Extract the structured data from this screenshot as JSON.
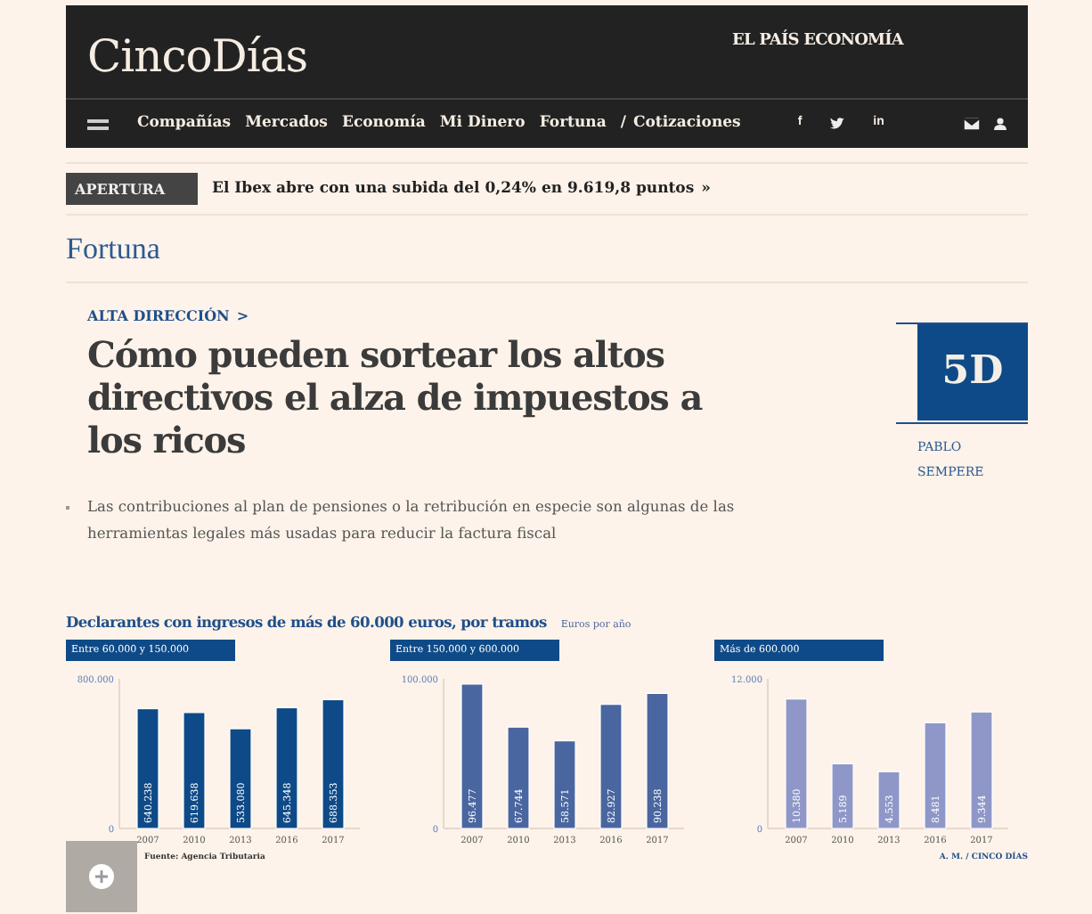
{
  "header": {
    "logo": "CincoDías",
    "partner": "EL PAÍS ECONOMÍA",
    "nav": [
      "Compañías",
      "Mercados",
      "Economía",
      "Mi Dinero",
      "Fortuna"
    ],
    "nav_separator": "/",
    "nav_extra": "Cotizaciones",
    "social": [
      {
        "kind": "text",
        "label": "f"
      },
      {
        "kind": "bird"
      },
      {
        "kind": "text",
        "label": "in"
      }
    ]
  },
  "ticker": {
    "tag": "APERTURA",
    "headline": "El Ibex abre con una subida del 0,24% en 9.619,8 puntos",
    "arrow": "»"
  },
  "section": "Fortuna",
  "article": {
    "kicker": "ALTA DIRECCIÓN",
    "kicker_arrow": ">",
    "title": "Cómo pueden sortear los altos directivos el alza de impuestos a los ricos",
    "summary": "Las contribuciones al plan de pensiones o la retribución en especie son algunas de las herramientas legales más usadas para reducir la factura fiscal",
    "author_logo": "5D",
    "author": "PABLO SEMPERE"
  },
  "infographic": {
    "title": "Declarantes con ingresos de más de 60.000 euros, por tramos",
    "unit": "Euros por año",
    "source": "Fuente: Agencia Tributaria",
    "credit": "A. M. / CINCO DÍAS",
    "panels": [
      {
        "chart_data": {
          "type": "bar",
          "categories": [
            "2007",
            "2010",
            "2013",
            "2016",
            "2017"
          ],
          "series": [
            {
              "name": "Entre 60.000 y 150.000",
              "color": "#0e4a87",
              "values": [
                640238,
                619638,
                533080,
                645348,
                688353
              ]
            }
          ],
          "ylim": [
            0,
            800000
          ],
          "yticks": [
            {
              "value": 0,
              "label": "0"
            },
            {
              "value": 800000,
              "label": "800.000"
            }
          ],
          "value_labels": [
            "640.238",
            "619.638",
            "533.080",
            "645.348",
            "688.353"
          ]
        }
      },
      {
        "chart_data": {
          "type": "bar",
          "categories": [
            "2007",
            "2010",
            "2013",
            "2016",
            "2017"
          ],
          "series": [
            {
              "name": "Entre 150.000 y 600.000",
              "color": "#4a66a0",
              "values": [
                96477,
                67744,
                58571,
                82927,
                90238
              ]
            }
          ],
          "ylim": [
            0,
            100000
          ],
          "yticks": [
            {
              "value": 0,
              "label": "0"
            },
            {
              "value": 100000,
              "label": "100.000"
            }
          ],
          "value_labels": [
            "96.477",
            "67.744",
            "58.571",
            "82.927",
            "90.238"
          ]
        }
      },
      {
        "chart_data": {
          "type": "bar",
          "categories": [
            "2007",
            "2010",
            "2013",
            "2016",
            "2017"
          ],
          "series": [
            {
              "name": "Más de 600.000",
              "color": "#8f97c8",
              "values": [
                10380,
                5189,
                4553,
                8481,
                9344
              ]
            }
          ],
          "ylim": [
            0,
            12000
          ],
          "yticks": [
            {
              "value": 0,
              "label": "0"
            },
            {
              "value": 12000,
              "label": "12.000"
            }
          ],
          "value_labels": [
            "10.380",
            "5.189",
            "4.553",
            "8.481",
            "9.344"
          ]
        }
      }
    ]
  }
}
